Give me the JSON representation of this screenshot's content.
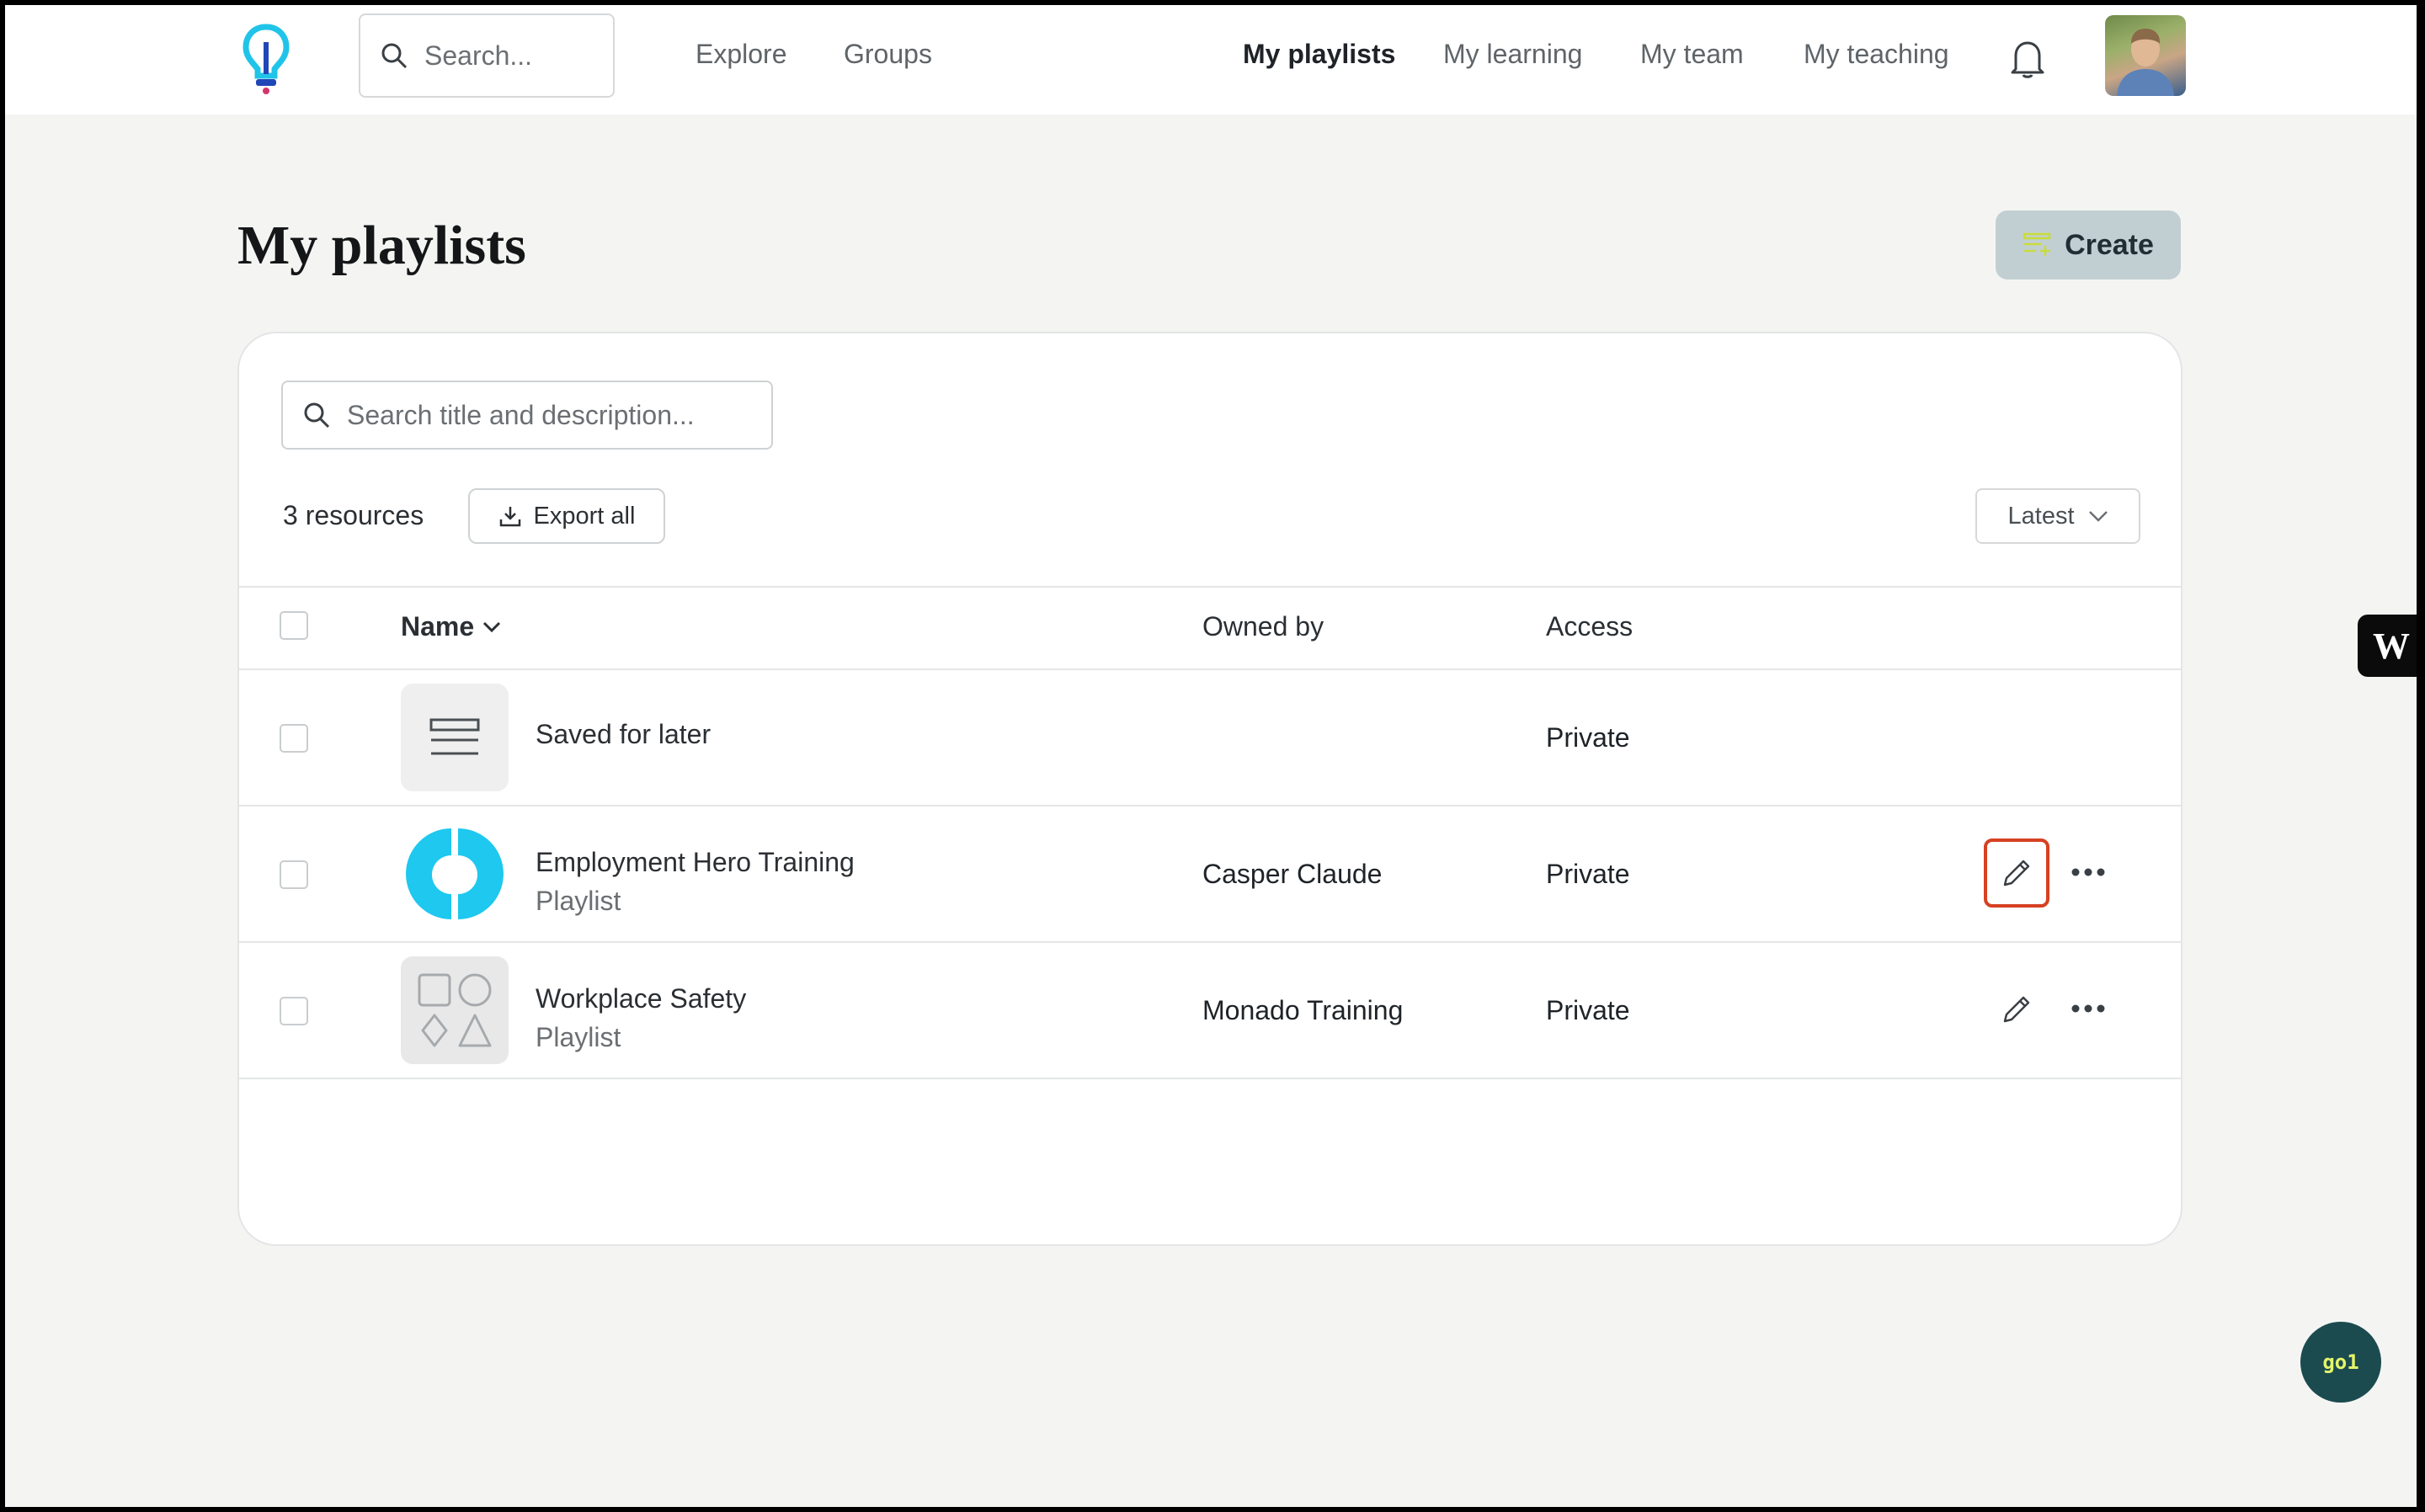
{
  "nav": {
    "search_placeholder": "Search...",
    "links": [
      "Explore",
      "Groups"
    ],
    "right_links": [
      "My playlists",
      "My learning",
      "My team",
      "My teaching"
    ],
    "active": "My playlists"
  },
  "page": {
    "title": "My playlists",
    "create_label": "Create"
  },
  "filters": {
    "search_placeholder": "Search title and description...",
    "resource_count": "3 resources",
    "export_label": "Export all",
    "sort_value": "Latest"
  },
  "table": {
    "headers": {
      "name": "Name",
      "owned_by": "Owned by",
      "access": "Access"
    },
    "rows": [
      {
        "title": "Saved for later",
        "subtitle": "",
        "owner": "",
        "access": "Private",
        "thumb": "list-icon"
      },
      {
        "title": "Employment Hero Training",
        "subtitle": "Playlist",
        "owner": "Casper Claude",
        "access": "Private",
        "thumb": "employment-hero-logo"
      },
      {
        "title": "Workplace Safety",
        "subtitle": "Playlist",
        "owner": "Monado Training",
        "access": "Private",
        "thumb": "shapes-icon"
      }
    ]
  },
  "widgets": {
    "go1_label": "go1",
    "w_label": "W"
  },
  "colors": {
    "accent_logo": "#20c4e8",
    "logo_dot": "#d6336c",
    "focus_ring": "#d64123",
    "create_bg": "#c2cfd2",
    "go1_bg": "#1b4b4f"
  }
}
